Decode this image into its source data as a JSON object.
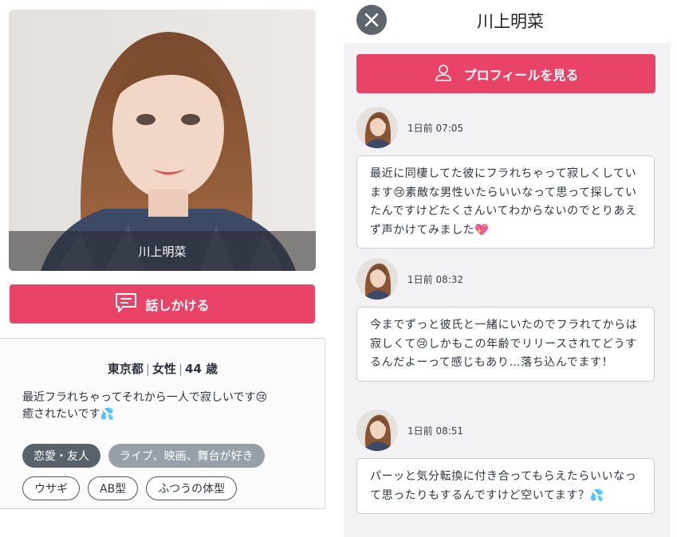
{
  "profile": {
    "name": "川上明菜",
    "talk_button_label": "話しかける",
    "prefecture": "東京都",
    "gender": "女性",
    "age": "44 歳",
    "bio_line1": "最近フラれちゃってそれから一人で寂しいです😢",
    "bio_line2": "癒されたいです💦",
    "tags": [
      {
        "label": "恋愛・友人",
        "style": "dark"
      },
      {
        "label": "ライブ、映画、舞台が好き",
        "style": "grey"
      },
      {
        "label": "ウサギ",
        "style": "outline"
      },
      {
        "label": "AB型",
        "style": "outline"
      },
      {
        "label": "ふつうの体型",
        "style": "outline"
      }
    ]
  },
  "chat": {
    "title": "川上明菜",
    "close_icon": "close-icon",
    "profile_button_label": "プロフィールを見る",
    "messages": [
      {
        "time": "1日前 07:05",
        "text": "最近に同棲してた彼にフラれちゃって寂しくしています😢素敵な男性いたらいいなって思って探していたんですけどたくさんいてわからないのでとりあえず声かけてみました💖"
      },
      {
        "time": "1日前 08:32",
        "text": "今までずっと彼氏と一緒にいたのでフラれてからは寂しくて😢しかもこの年齢でリリースされてどうするんだよーって感じもあり…落ち込んでます！"
      },
      {
        "time": "1日前 08:51",
        "text": "パーッと気分転換に付き合ってもらえたらいいなって思ったりもするんですけど空いてます？💦"
      }
    ]
  },
  "colors": {
    "accent": "#e94468",
    "tag_dark": "#59616a",
    "tag_grey": "#98a0a7",
    "chat_bg": "#f2f2f4"
  }
}
